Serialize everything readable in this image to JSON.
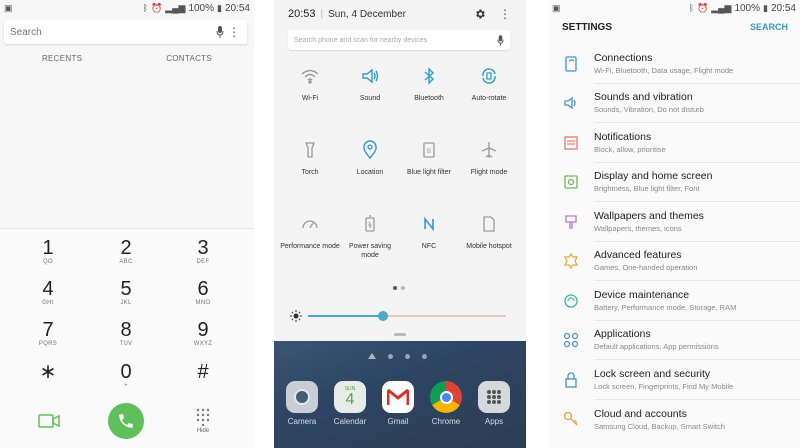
{
  "status": {
    "battery": "100%",
    "time": "20:54"
  },
  "dialer": {
    "search_placeholder": "Search",
    "tabs": [
      "RECENTS",
      "CONTACTS"
    ],
    "keys": [
      {
        "num": "1",
        "letters": "QO"
      },
      {
        "num": "2",
        "letters": "ABC"
      },
      {
        "num": "3",
        "letters": "DEF"
      },
      {
        "num": "4",
        "letters": "GHI"
      },
      {
        "num": "5",
        "letters": "JKL"
      },
      {
        "num": "6",
        "letters": "MNO"
      },
      {
        "num": "7",
        "letters": "PQRS"
      },
      {
        "num": "8",
        "letters": "TUV"
      },
      {
        "num": "9",
        "letters": "WXYZ"
      },
      {
        "num": "∗",
        "letters": ""
      },
      {
        "num": "0",
        "letters": "+"
      },
      {
        "num": "#",
        "letters": ""
      }
    ],
    "hide_label": "Hide"
  },
  "quick_panel": {
    "time": "20:53",
    "date": "Sun, 4 December",
    "search_placeholder": "Search phone and scan for nearby devices",
    "tiles": [
      {
        "label": "Wi-Fi",
        "icon": "wifi-icon",
        "on": false
      },
      {
        "label": "Sound",
        "icon": "sound-icon",
        "on": true
      },
      {
        "label": "Bluetooth",
        "icon": "bluetooth-icon",
        "on": true
      },
      {
        "label": "Auto-rotate",
        "icon": "auto-rotate-icon",
        "on": true
      },
      {
        "label": "Torch",
        "icon": "torch-icon",
        "on": false
      },
      {
        "label": "Location",
        "icon": "location-icon",
        "on": true
      },
      {
        "label": "Blue light filter",
        "icon": "blue-light-icon",
        "on": false
      },
      {
        "label": "Flight mode",
        "icon": "flight-icon",
        "on": false
      },
      {
        "label": "Performance mode",
        "icon": "performance-icon",
        "on": false
      },
      {
        "label": "Power saving mode",
        "icon": "power-saving-icon",
        "on": false
      },
      {
        "label": "NFC",
        "icon": "nfc-icon",
        "on": true
      },
      {
        "label": "Mobile hotspot",
        "icon": "hotspot-icon",
        "on": false
      }
    ],
    "brightness": 0.38,
    "apps": [
      "Camera",
      "Calendar",
      "Gmail",
      "Chrome",
      "Apps"
    ],
    "calendar_day": "SUN",
    "calendar_date": "4"
  },
  "settings": {
    "title": "SETTINGS",
    "search": "SEARCH",
    "accent": "#3a9bbd",
    "items": [
      {
        "title": "Connections",
        "sub": "Wi-Fi, Bluetooth, Data usage, Flight mode",
        "icon": "connections-icon",
        "color": "#4a90c8"
      },
      {
        "title": "Sounds and vibration",
        "sub": "Sounds, Vibration, Do not disturb",
        "icon": "sound-icon",
        "color": "#4a90c8"
      },
      {
        "title": "Notifications",
        "sub": "Block, allow, prioritise",
        "icon": "notifications-icon",
        "color": "#e57b6b"
      },
      {
        "title": "Display and home screen",
        "sub": "Brightness, Blue light filter, Font",
        "icon": "display-icon",
        "color": "#6fb65a"
      },
      {
        "title": "Wallpapers and themes",
        "sub": "Wallpapers, themes, icons",
        "icon": "wallpaper-icon",
        "color": "#b57ac9"
      },
      {
        "title": "Advanced features",
        "sub": "Games, One-handed operation",
        "icon": "advanced-icon",
        "color": "#e7a23b"
      },
      {
        "title": "Device maintenance",
        "sub": "Battery, Performance mode, Storage, RAM",
        "icon": "maintenance-icon",
        "color": "#3fb3a2"
      },
      {
        "title": "Applications",
        "sub": "Default applications, App permissions",
        "icon": "applications-icon",
        "color": "#4a90c8"
      },
      {
        "title": "Lock screen and security",
        "sub": "Lock screen, Fingerprints, Find My Mobile",
        "icon": "lock-icon",
        "color": "#4a90c8"
      },
      {
        "title": "Cloud and accounts",
        "sub": "Samsung Cloud, Backup, Smart Switch",
        "icon": "key-icon",
        "color": "#e7a23b"
      }
    ]
  }
}
